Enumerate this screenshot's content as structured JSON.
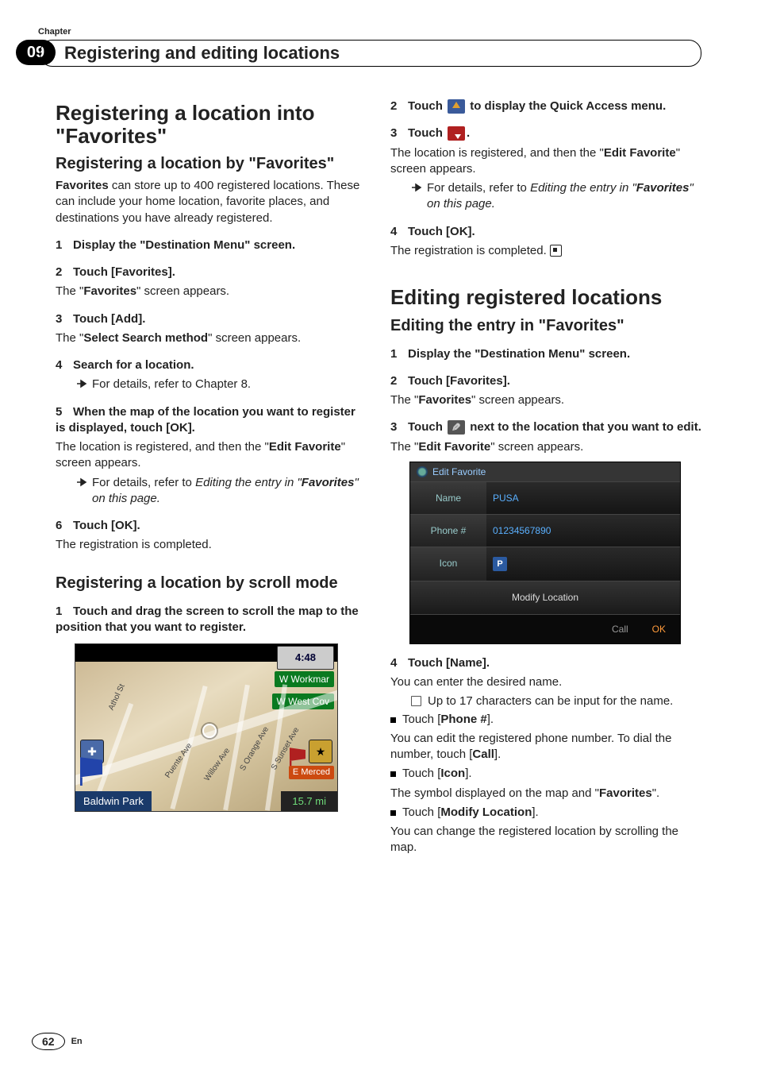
{
  "chapter": {
    "label": "Chapter",
    "number": "09",
    "title": "Registering and editing locations"
  },
  "left": {
    "h1": "Registering a location into \"Favorites\"",
    "h2a": "Registering a location by \"Favorites\"",
    "intro_bold": "Favorites",
    "intro_rest": " can store up to 400 registered locations. These can include your home location, favorite places, and destinations you have already registered.",
    "s1": "Display the \"Destination Menu\" screen.",
    "s2": "Touch [Favorites].",
    "s2_after_pre": "The \"",
    "s2_after_bold": "Favorites",
    "s2_after_post": "\" screen appears.",
    "s3": "Touch [Add].",
    "s3_after_pre": "The \"",
    "s3_after_bold": "Select Search method",
    "s3_after_post": "\" screen appears.",
    "s4": "Search for a location.",
    "s4_bullet": "For details, refer to Chapter 8.",
    "s5": "When the map of the location you want to register is displayed, touch [OK].",
    "s5_after_pre": "The location is registered, and then the \"",
    "s5_after_bold": "Edit Favorite",
    "s5_after_post": "\" screen appears.",
    "s5_bullet_pre": "For details, refer to ",
    "s5_bullet_it": "Editing the entry in \"",
    "s5_bullet_bold": "Favorites",
    "s5_bullet_post": "\" on this page.",
    "s6": "Touch [OK].",
    "s6_after": "The registration is completed.",
    "h2b": "Registering a location by scroll mode",
    "sb1": "Touch and drag the screen to scroll the map to the position that you want to register.",
    "map": {
      "time": "4:48",
      "g1": "W Workmar",
      "g2": "W West Cov",
      "emerced": "E Merced",
      "r1": "Puente Ave",
      "r2": "Willow Ave",
      "r4": "S Orange Ave",
      "r5": "S Sunset Ave",
      "r6": "Athol St",
      "bl": "Baldwin Park",
      "br": "15.7 mi"
    }
  },
  "right": {
    "s2_pre": "Touch ",
    "s2_post": " to display the Quick Access menu.",
    "s3_pre": "Touch ",
    "s3_post": ".",
    "s3_after_pre": "The location is registered, and then the \"",
    "s3_after_bold": "Edit Favorite",
    "s3_after_post": "\" screen appears.",
    "s3_bullet_pre": "For details, refer to ",
    "s3_bullet_it": "Editing the entry in \"",
    "s3_bullet_bold": "Favorites",
    "s3_bullet_post": "\" on this page.",
    "s4": "Touch [OK].",
    "s4_after": "The registration is completed.",
    "h1b": "Editing registered locations",
    "h2b": "Editing the entry in \"Favorites\"",
    "b1": "Display the \"Destination Menu\" screen.",
    "b2": "Touch [Favorites].",
    "b2_after_pre": "The \"",
    "b2_after_bold": "Favorites",
    "b2_after_post": "\" screen appears.",
    "b3_pre": "Touch ",
    "b3_post": " next to the location that you want to edit.",
    "b3_after_pre": "The \"",
    "b3_after_bold": "Edit Favorite",
    "b3_after_post": "\" screen appears.",
    "editfav": {
      "title": "Edit Favorite",
      "name_l": "Name",
      "name_v": "PUSA",
      "phone_l": "Phone #",
      "phone_v": "01234567890",
      "icon_l": "Icon",
      "icon_v": "P",
      "modify": "Modify Location",
      "call": "Call",
      "ok": "OK"
    },
    "b4": "Touch [Name].",
    "b4_after": "You can enter the desired name.",
    "b4_note": "Up to 17 characters can be input for the name.",
    "sq1_pre": "Touch [",
    "sq1_bold": "Phone #",
    "sq1_post": "].",
    "sq1_after_pre": "You can edit the registered phone number. To dial the number, touch [",
    "sq1_after_bold": "Call",
    "sq1_after_post": "].",
    "sq2_pre": "Touch [",
    "sq2_bold": "Icon",
    "sq2_post": "].",
    "sq2_after_pre": "The symbol displayed on the map and \"",
    "sq2_after_bold": "Favorites",
    "sq2_after_post": "\".",
    "sq3_pre": "Touch [",
    "sq3_bold": "Modify Location",
    "sq3_post": "].",
    "sq3_after": "You can change the registered location by scrolling the map."
  },
  "footer": {
    "page": "62",
    "lang": "En"
  }
}
